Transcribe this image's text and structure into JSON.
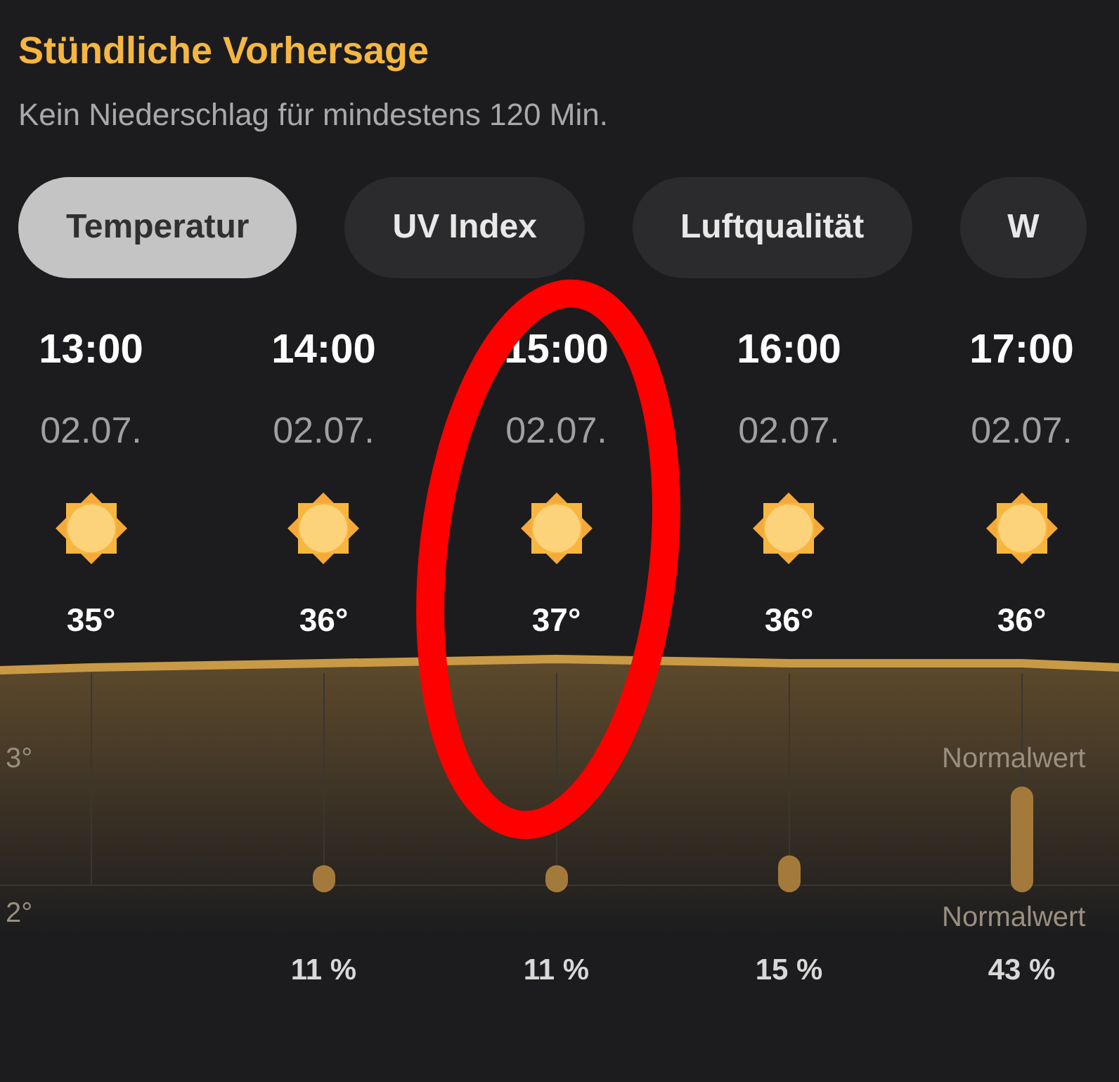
{
  "title": "Stündliche Vorhersage",
  "subtitle": "Kein Niederschlag für mindestens 120 Min.",
  "tabs": [
    {
      "label": "Temperatur",
      "selected": true
    },
    {
      "label": "UV Index",
      "selected": false
    },
    {
      "label": "Luftqualität",
      "selected": false
    },
    {
      "label": "W",
      "selected": false
    }
  ],
  "hours": [
    {
      "time": "13:00",
      "date": "02.07.",
      "temp": "35°"
    },
    {
      "time": "14:00",
      "date": "02.07.",
      "temp": "36°",
      "precip": {
        "reading": "11 %"
      }
    },
    {
      "time": "15:00",
      "date": "02.07.",
      "temp": "37°",
      "precip": {
        "reading": "11 %"
      }
    },
    {
      "time": "16:00",
      "date": "02.07.",
      "temp": "36°",
      "precip": {
        "reading": "15 %"
      }
    },
    {
      "time": "17:00",
      "date": "02.07.",
      "temp": "36°",
      "precip": {
        "reading": "43 %"
      }
    }
  ],
  "axis_labels": [
    "3°",
    "2°"
  ],
  "normal_labels": [
    "Normalwert",
    "Normalwert"
  ]
}
